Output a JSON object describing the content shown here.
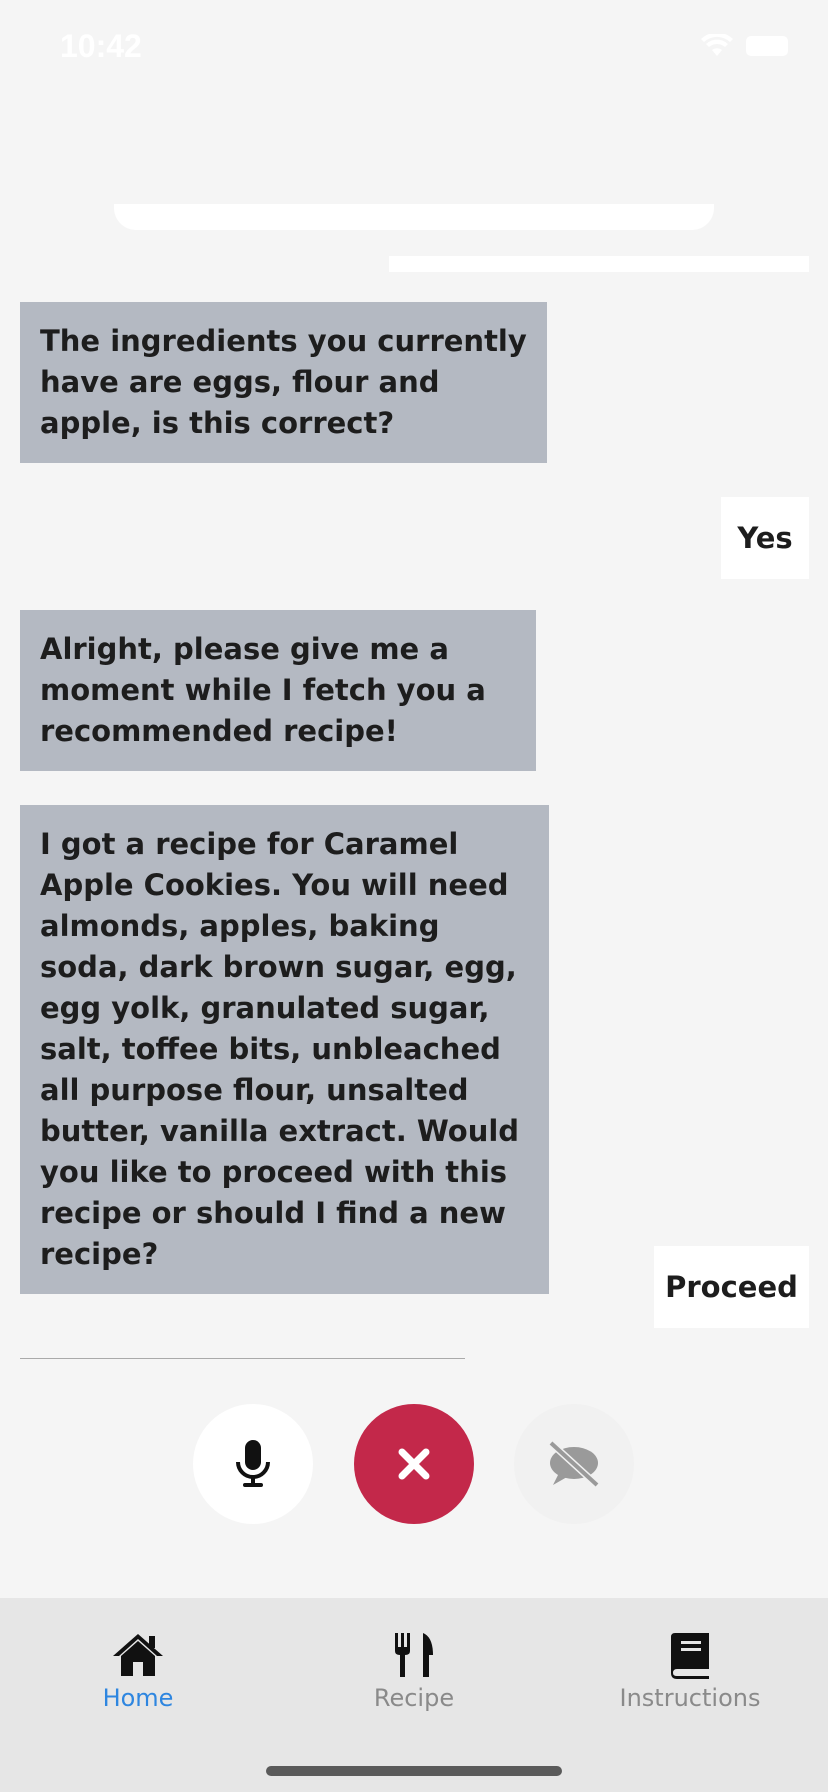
{
  "status_bar": {
    "time": "10:42"
  },
  "chat": {
    "messages": [
      {
        "from": "bot",
        "text": "The ingredients you currently have are eggs, flour and apple, is this correct?"
      },
      {
        "from": "user",
        "text": "Yes"
      },
      {
        "from": "bot",
        "text": "Alright, please give me a moment while I fetch you a recommended recipe!"
      },
      {
        "from": "bot",
        "text": "I got a recipe for Caramel Apple Cookies. You will need almonds, apples, baking soda, dark brown sugar, egg, egg yolk, granulated sugar, salt, toffee bits, unbleached all purpose flour, unsalted butter, vanilla extract. Would you like to proceed with this recipe or should I find a new recipe?"
      },
      {
        "from": "user",
        "text": "Proceed"
      }
    ]
  },
  "controls": {
    "mic_icon": "microphone-icon",
    "close_icon": "close-icon",
    "mute_icon": "speech-off-icon",
    "close_color": "#c3284a"
  },
  "tabs": [
    {
      "label": "Home",
      "icon": "home-icon",
      "active": true
    },
    {
      "label": "Recipe",
      "icon": "utensils-icon",
      "active": false
    },
    {
      "label": "Instructions",
      "icon": "book-icon",
      "active": false
    }
  ],
  "colors": {
    "active_tab": "#2e86e0",
    "inactive_tab": "#8a8a8a",
    "bot_bubble": "#b4b9c2"
  }
}
